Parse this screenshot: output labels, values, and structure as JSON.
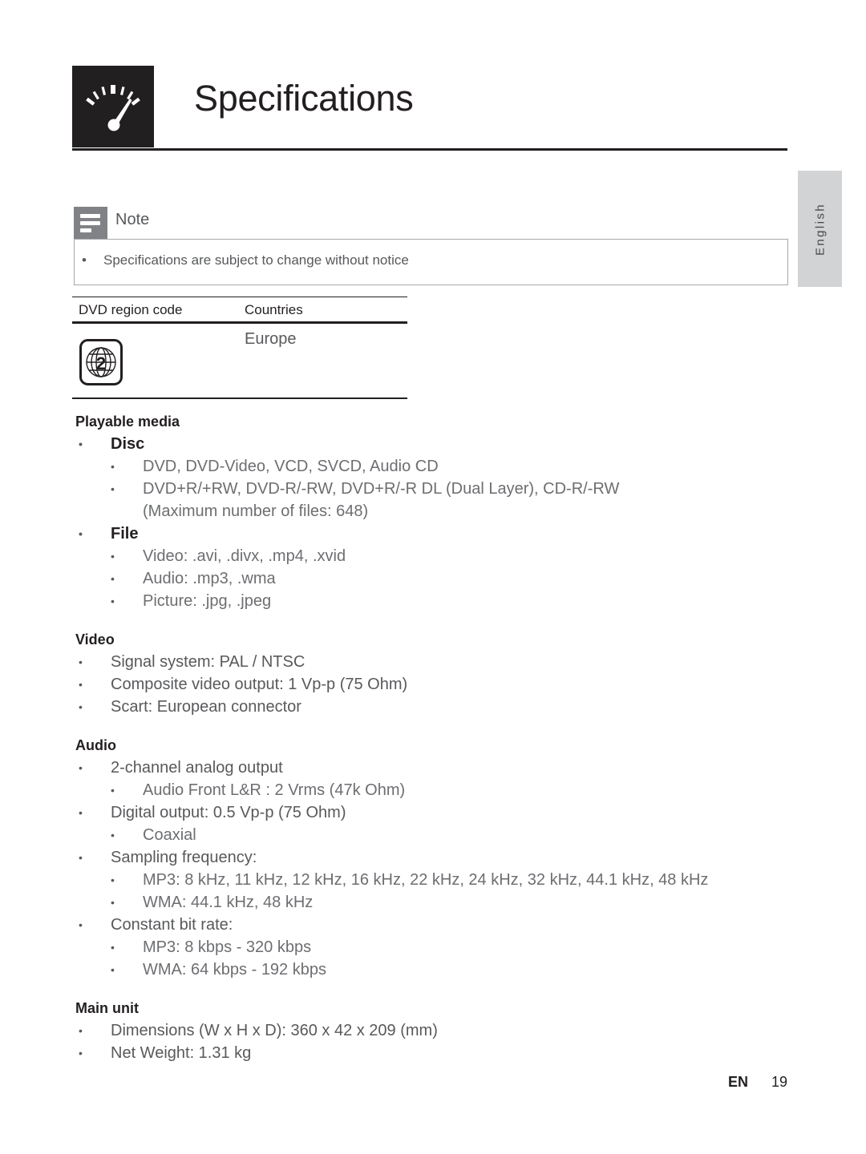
{
  "header": {
    "title": "Specifications",
    "icon": "speedometer-icon"
  },
  "side_tab": {
    "label": "English"
  },
  "note": {
    "icon": "note-lines-icon",
    "label": "Note",
    "bullet": "•",
    "items": [
      "Specifications are subject to change without notice"
    ]
  },
  "region_table": {
    "columns": [
      "DVD region code",
      "Countries"
    ],
    "rows": [
      {
        "region_icon": "dvd-region-2-globe-icon",
        "region_number": "2",
        "country": "Europe"
      }
    ]
  },
  "sections": [
    {
      "heading": "Playable media",
      "items": [
        {
          "level": 1,
          "bullet": "•",
          "text": "Disc",
          "strong": true
        },
        {
          "level": 2,
          "bullet": "•",
          "text": "DVD, DVD-Video, VCD, SVCD, Audio CD"
        },
        {
          "level": 2,
          "bullet": "•",
          "text": "DVD+R/+RW, DVD-R/-RW, DVD+R/-R DL (Dual Layer), CD-R/-RW",
          "cont": "(Maximum number of files: 648)"
        },
        {
          "level": 1,
          "bullet": "•",
          "text": "File",
          "strong": true
        },
        {
          "level": 2,
          "bullet": "•",
          "text": "Video: .avi, .divx, .mp4, .xvid"
        },
        {
          "level": 2,
          "bullet": "•",
          "text": "Audio: .mp3, .wma"
        },
        {
          "level": 2,
          "bullet": "•",
          "text": "Picture: .jpg, .jpeg"
        }
      ]
    },
    {
      "heading": "Video",
      "items": [
        {
          "level": 1,
          "bullet": "•",
          "text": "Signal system: PAL / NTSC"
        },
        {
          "level": 1,
          "bullet": "•",
          "text": "Composite video output: 1 Vp-p (75 Ohm)"
        },
        {
          "level": 1,
          "bullet": "•",
          "text": "Scart: European connector"
        }
      ]
    },
    {
      "heading": "Audio",
      "items": [
        {
          "level": 1,
          "bullet": "•",
          "text": "2-channel analog output"
        },
        {
          "level": 2,
          "bullet": "•",
          "text": "Audio Front L&R : 2 Vrms (47k Ohm)"
        },
        {
          "level": 1,
          "bullet": "•",
          "text": "Digital output: 0.5 Vp-p (75 Ohm)"
        },
        {
          "level": 2,
          "bullet": "•",
          "text": "Coaxial"
        },
        {
          "level": 1,
          "bullet": "•",
          "text": "Sampling frequency:"
        },
        {
          "level": 2,
          "bullet": "•",
          "text": "MP3: 8 kHz, 11 kHz, 12 kHz, 16 kHz, 22 kHz, 24 kHz, 32 kHz, 44.1 kHz, 48 kHz"
        },
        {
          "level": 2,
          "bullet": "•",
          "text": "WMA: 44.1 kHz, 48 kHz"
        },
        {
          "level": 1,
          "bullet": "•",
          "text": "Constant bit rate:"
        },
        {
          "level": 2,
          "bullet": "•",
          "text": "MP3: 8 kbps - 320 kbps"
        },
        {
          "level": 2,
          "bullet": "•",
          "text": "WMA: 64 kbps - 192 kbps"
        }
      ]
    },
    {
      "heading": "Main unit",
      "items": [
        {
          "level": 1,
          "bullet": "•",
          "text": "Dimensions (W x H x D): 360 x 42 x 209 (mm)"
        },
        {
          "level": 1,
          "bullet": "•",
          "text": "Net Weight: 1.31 kg"
        }
      ]
    }
  ],
  "footer": {
    "language": "EN",
    "page_number": "19"
  },
  "colors": {
    "header_bar": "#231f20",
    "note_gray": "#808285",
    "tab_gray": "#d2d3d5",
    "body_text": "#58595b"
  }
}
